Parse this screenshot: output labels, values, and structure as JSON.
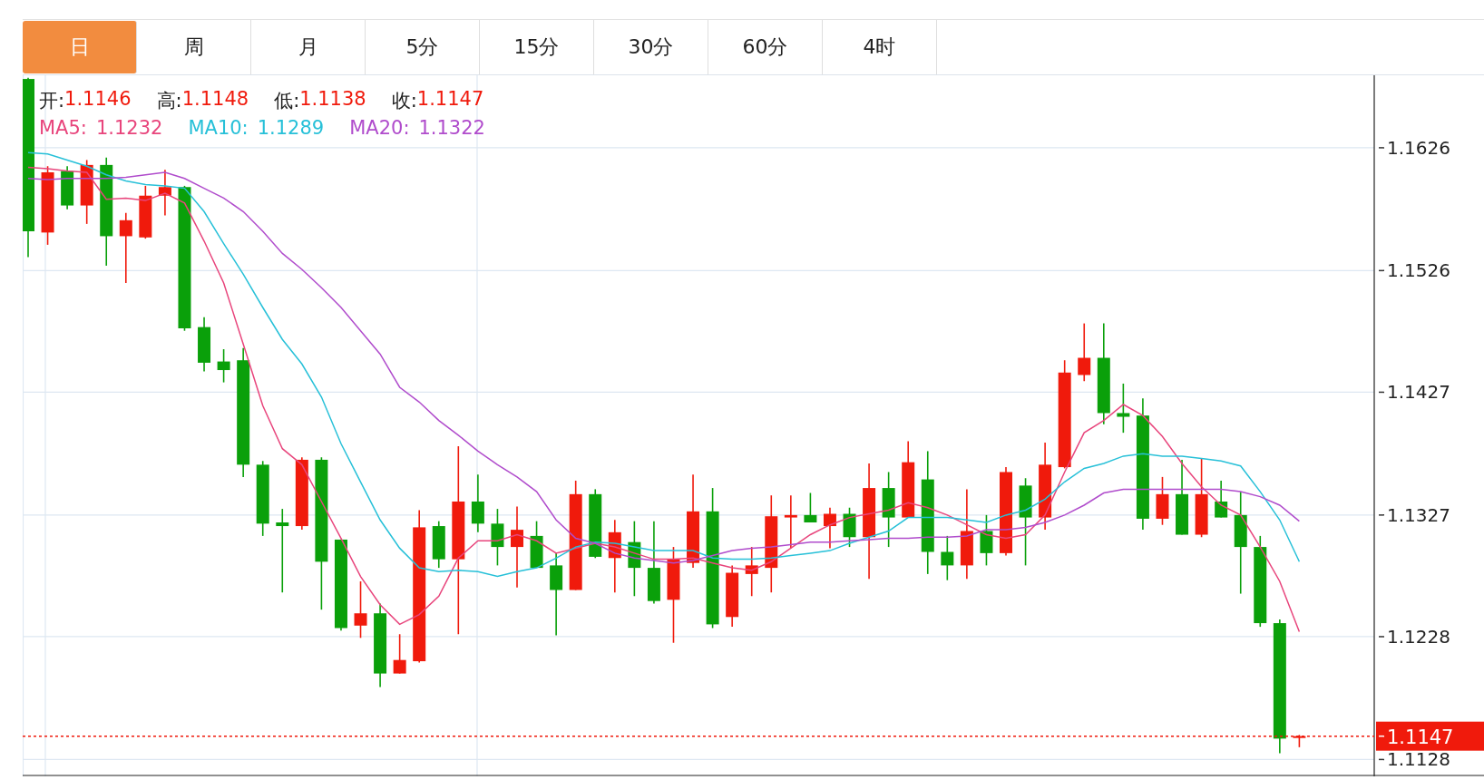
{
  "tabs": [
    {
      "label": "日",
      "selected": true
    },
    {
      "label": "周",
      "selected": false
    },
    {
      "label": "月",
      "selected": false
    },
    {
      "label": "5分",
      "selected": false
    },
    {
      "label": "15分",
      "selected": false
    },
    {
      "label": "30分",
      "selected": false
    },
    {
      "label": "60分",
      "selected": false
    },
    {
      "label": "4时",
      "selected": false
    }
  ],
  "quote": [
    {
      "label": "开:",
      "value": "1.1146"
    },
    {
      "label": "高:",
      "value": "1.1148"
    },
    {
      "label": "低:",
      "value": "1.1138"
    },
    {
      "label": "收:",
      "value": "1.1147"
    }
  ],
  "ma_legend": [
    {
      "value": "1.1232"
    },
    {
      "value": "1.1289"
    },
    {
      "value": "1.1322"
    }
  ],
  "chart": {
    "chart_data": {
      "type": "candlestick",
      "ylim": [
        1.1115,
        1.1685
      ],
      "grid": true,
      "yticks": [
        1.1128,
        1.1228,
        1.1327,
        1.1427,
        1.1526,
        1.1626
      ],
      "categories": [
        null,
        null,
        null,
        null,
        null,
        null,
        null,
        null,
        null,
        null,
        null,
        null,
        null,
        null,
        null,
        null,
        null,
        null,
        null,
        null,
        null,
        null,
        null,
        null,
        null,
        null,
        null,
        null,
        null,
        null,
        null,
        null,
        null,
        null,
        null,
        null,
        null,
        null,
        null,
        null,
        null,
        null,
        null,
        null,
        null,
        null,
        null,
        null,
        null,
        null,
        null,
        null,
        null,
        null,
        null,
        null,
        null,
        null,
        null,
        null,
        null,
        null,
        null,
        null,
        null,
        null
      ],
      "ohlc": [
        [
          1.1682,
          1.1683,
          1.1537,
          1.1558
        ],
        [
          1.1557,
          1.1611,
          1.1547,
          1.1606
        ],
        [
          1.1607,
          1.1611,
          1.1576,
          1.1579
        ],
        [
          1.1579,
          1.1616,
          1.1564,
          1.1612
        ],
        [
          1.1612,
          1.1618,
          1.153,
          1.1554
        ],
        [
          1.1554,
          1.1573,
          1.1516,
          1.1567
        ],
        [
          1.1553,
          1.1595,
          1.1552,
          1.1587
        ],
        [
          1.1587,
          1.1608,
          1.1571,
          1.1594
        ],
        [
          1.1594,
          1.1595,
          1.1477,
          1.1479
        ],
        [
          1.148,
          1.1488,
          1.1444,
          1.1451
        ],
        [
          1.1452,
          1.1462,
          1.1435,
          1.1445
        ],
        [
          1.1453,
          1.1463,
          1.1358,
          1.1368
        ],
        [
          1.1368,
          1.1371,
          1.131,
          1.132
        ],
        [
          1.1321,
          1.1332,
          1.1264,
          1.1318
        ],
        [
          1.1318,
          1.1374,
          1.1315,
          1.1372
        ],
        [
          1.1372,
          1.1374,
          1.125,
          1.1289
        ],
        [
          1.1307,
          1.1307,
          1.1233,
          1.1235
        ],
        [
          1.1237,
          1.1273,
          1.1227,
          1.1247
        ],
        [
          1.1247,
          1.1255,
          1.1187,
          1.1198
        ],
        [
          1.1198,
          1.123,
          1.1198,
          1.1209
        ],
        [
          1.1208,
          1.1331,
          1.1207,
          1.1317
        ],
        [
          1.1318,
          1.1322,
          1.1284,
          1.1291
        ],
        [
          1.1291,
          1.1383,
          1.123,
          1.1338
        ],
        [
          1.1338,
          1.136,
          1.1313,
          1.132
        ],
        [
          1.132,
          1.1332,
          1.1286,
          1.1301
        ],
        [
          1.1301,
          1.1334,
          1.1268,
          1.1315
        ],
        [
          1.131,
          1.1322,
          1.1284,
          1.1284
        ],
        [
          1.1286,
          1.1296,
          1.1229,
          1.1266
        ],
        [
          1.1266,
          1.1355,
          1.1266,
          1.1344
        ],
        [
          1.1344,
          1.1348,
          1.1292,
          1.1293
        ],
        [
          1.1292,
          1.1323,
          1.1264,
          1.1313
        ],
        [
          1.1305,
          1.1322,
          1.1261,
          1.1284
        ],
        [
          1.1284,
          1.1322,
          1.1255,
          1.1257
        ],
        [
          1.1258,
          1.1301,
          1.1223,
          1.1291
        ],
        [
          1.1288,
          1.136,
          1.1284,
          1.133
        ],
        [
          1.133,
          1.1349,
          1.1235,
          1.1238
        ],
        [
          1.1244,
          1.1286,
          1.1236,
          1.128
        ],
        [
          1.1279,
          1.1301,
          1.1261,
          1.1286
        ],
        [
          1.1284,
          1.1343,
          1.1264,
          1.1326
        ],
        [
          1.1325,
          1.1343,
          1.13,
          1.1327
        ],
        [
          1.1327,
          1.1345,
          1.1321,
          1.1321
        ],
        [
          1.1318,
          1.1333,
          1.13,
          1.1328
        ],
        [
          1.1328,
          1.1333,
          1.1301,
          1.1309
        ],
        [
          1.1309,
          1.1369,
          1.1275,
          1.1349
        ],
        [
          1.1349,
          1.1362,
          1.1301,
          1.1325
        ],
        [
          1.1325,
          1.1387,
          1.1325,
          1.137
        ],
        [
          1.1356,
          1.1379,
          1.1279,
          1.1297
        ],
        [
          1.1297,
          1.131,
          1.1274,
          1.1286
        ],
        [
          1.1286,
          1.1348,
          1.1275,
          1.1314
        ],
        [
          1.1314,
          1.1327,
          1.1286,
          1.1296
        ],
        [
          1.1296,
          1.1366,
          1.1294,
          1.1362
        ],
        [
          1.1351,
          1.1357,
          1.1286,
          1.1325
        ],
        [
          1.1325,
          1.1386,
          1.1315,
          1.1368
        ],
        [
          1.1366,
          1.1453,
          1.1365,
          1.1443
        ],
        [
          1.1441,
          1.1483,
          1.1436,
          1.1455
        ],
        [
          1.1455,
          1.1483,
          1.1401,
          1.141
        ],
        [
          1.141,
          1.1434,
          1.1394,
          1.1407
        ],
        [
          1.1408,
          1.1422,
          1.1315,
          1.1324
        ],
        [
          1.1324,
          1.1358,
          1.1319,
          1.1344
        ],
        [
          1.1344,
          1.1372,
          1.1311,
          1.1311
        ],
        [
          1.1311,
          1.1373,
          1.1309,
          1.1344
        ],
        [
          1.1338,
          1.1355,
          1.1325,
          1.1325
        ],
        [
          1.1327,
          1.1346,
          1.1263,
          1.1301
        ],
        [
          1.1301,
          1.131,
          1.1236,
          1.1239
        ],
        [
          1.1239,
          1.1242,
          1.1133,
          1.1145
        ],
        [
          1.1146,
          1.1148,
          1.1138,
          1.1147
        ]
      ],
      "series": [
        {
          "name": "MA5:",
          "type": "line",
          "color": "#e8457c",
          "values": [
            1.161,
            1.1609,
            1.1607,
            1.1606,
            1.1584,
            1.1585,
            1.1583,
            1.1589,
            1.1581,
            1.155,
            1.1516,
            1.1466,
            1.1416,
            1.1381,
            1.1368,
            1.1338,
            1.1308,
            1.1277,
            1.1254,
            1.1238,
            1.1246,
            1.1261,
            1.1292,
            1.1306,
            1.1306,
            1.1311,
            1.1306,
            1.1296,
            1.13,
            1.1304,
            1.1301,
            1.1296,
            1.1291,
            1.1291,
            1.1292,
            1.1288,
            1.1284,
            1.1282,
            1.1289,
            1.13,
            1.1311,
            1.1319,
            1.1325,
            1.1328,
            1.1331,
            1.1337,
            1.1333,
            1.1327,
            1.1319,
            1.1311,
            1.1308,
            1.1311,
            1.1327,
            1.1362,
            1.1394,
            1.1404,
            1.1417,
            1.1408,
            1.1391,
            1.1369,
            1.135,
            1.1335,
            1.1327,
            1.1301,
            1.1273,
            1.1232
          ]
        },
        {
          "name": "MA10:",
          "type": "line",
          "color": "#27c0d8",
          "values": [
            1.1622,
            1.1621,
            1.1616,
            1.1611,
            1.1604,
            1.1599,
            1.1596,
            1.1595,
            1.1593,
            1.1574,
            1.1548,
            1.1523,
            1.1496,
            1.147,
            1.145,
            1.1423,
            1.1385,
            1.1354,
            1.1323,
            1.13,
            1.1284,
            1.1281,
            1.1282,
            1.1281,
            1.1277,
            1.1281,
            1.1284,
            1.1292,
            1.1301,
            1.1305,
            1.1304,
            1.1301,
            1.1298,
            1.1298,
            1.1298,
            1.1292,
            1.1291,
            1.1291,
            1.1292,
            1.1294,
            1.1296,
            1.1298,
            1.1304,
            1.1309,
            1.1314,
            1.1325,
            1.1325,
            1.1325,
            1.1323,
            1.1321,
            1.1327,
            1.1331,
            1.134,
            1.1354,
            1.1365,
            1.1369,
            1.1375,
            1.1377,
            1.1375,
            1.1375,
            1.1373,
            1.1371,
            1.1367,
            1.1346,
            1.1323,
            1.1289
          ]
        },
        {
          "name": "MA20:",
          "type": "line",
          "color": "#b04ccc",
          "values": [
            1.1601,
            1.16,
            1.1601,
            1.1601,
            1.1601,
            1.1602,
            1.1604,
            1.1606,
            1.1601,
            1.1593,
            1.1585,
            1.1574,
            1.1558,
            1.154,
            1.1527,
            1.1512,
            1.1496,
            1.1477,
            1.1458,
            1.1431,
            1.1419,
            1.1404,
            1.1392,
            1.1379,
            1.1368,
            1.1358,
            1.1346,
            1.1323,
            1.1308,
            1.1304,
            1.1296,
            1.1292,
            1.129,
            1.1288,
            1.129,
            1.1294,
            1.1298,
            1.13,
            1.1301,
            1.1303,
            1.1305,
            1.1305,
            1.1306,
            1.1307,
            1.1308,
            1.1308,
            1.1309,
            1.1309,
            1.131,
            1.1315,
            1.1315,
            1.1317,
            1.1321,
            1.1327,
            1.1335,
            1.1345,
            1.1348,
            1.1348,
            1.1348,
            1.1348,
            1.1348,
            1.1348,
            1.1346,
            1.1342,
            1.1335,
            1.1322
          ]
        }
      ],
      "ref_lines": [
        {
          "axis": "y",
          "value": 1.1147,
          "label": "1.1147"
        }
      ]
    }
  }
}
